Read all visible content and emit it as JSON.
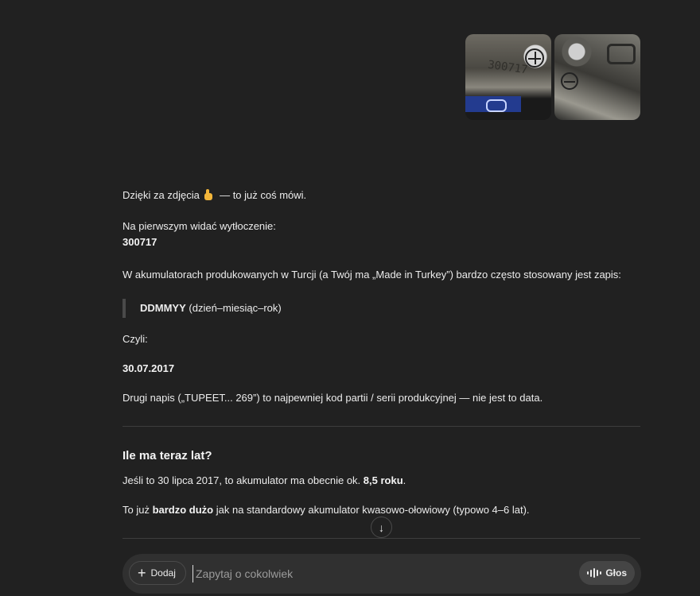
{
  "uploads": {
    "image_1_emboss": "300717",
    "image_icons": [
      "battery-terminal-photo",
      "battery-marking-photo"
    ]
  },
  "answer": {
    "thanks_before": "Dzięki za zdjęcia",
    "thanks_after": "— to już coś mówi.",
    "first_photo_text": "Na pierwszym widać wytłoczenie:",
    "code": "300717",
    "turkey_text": "W akumulatorach produkowanych w Turcji (a Twój ma „Made in Turkey”) bardzo często stosowany jest zapis:",
    "format_bold": "DDMMYY",
    "format_rest": " (dzień–miesiąc–rok)",
    "czyli": "Czyli:",
    "date": "30.07.2017",
    "second_text": "Drugi napis („TUPEET... 269”) to najpewniej kod partii / serii produkcyjnej — nie jest to data.",
    "heading_age": "Ile ma teraz lat?",
    "age_text_before": "Jeśli to 30 lipca 2017, to akumulator ma obecnie ok. ",
    "age_bold": "8,5 roku",
    "age_text_after": ".",
    "old_before": "To już ",
    "old_bold": "bardzo dużo",
    "old_after": " jak na standardowy akumulator kwasowo-ołowiowy (typowo 4–6 lat)."
  },
  "composer": {
    "add_label": "Dodaj",
    "placeholder": "Zapytaj o cokolwiek",
    "voice_label": "Głos"
  },
  "colors": {
    "background": "#212121",
    "composer": "#303030",
    "text": "#ececec"
  }
}
